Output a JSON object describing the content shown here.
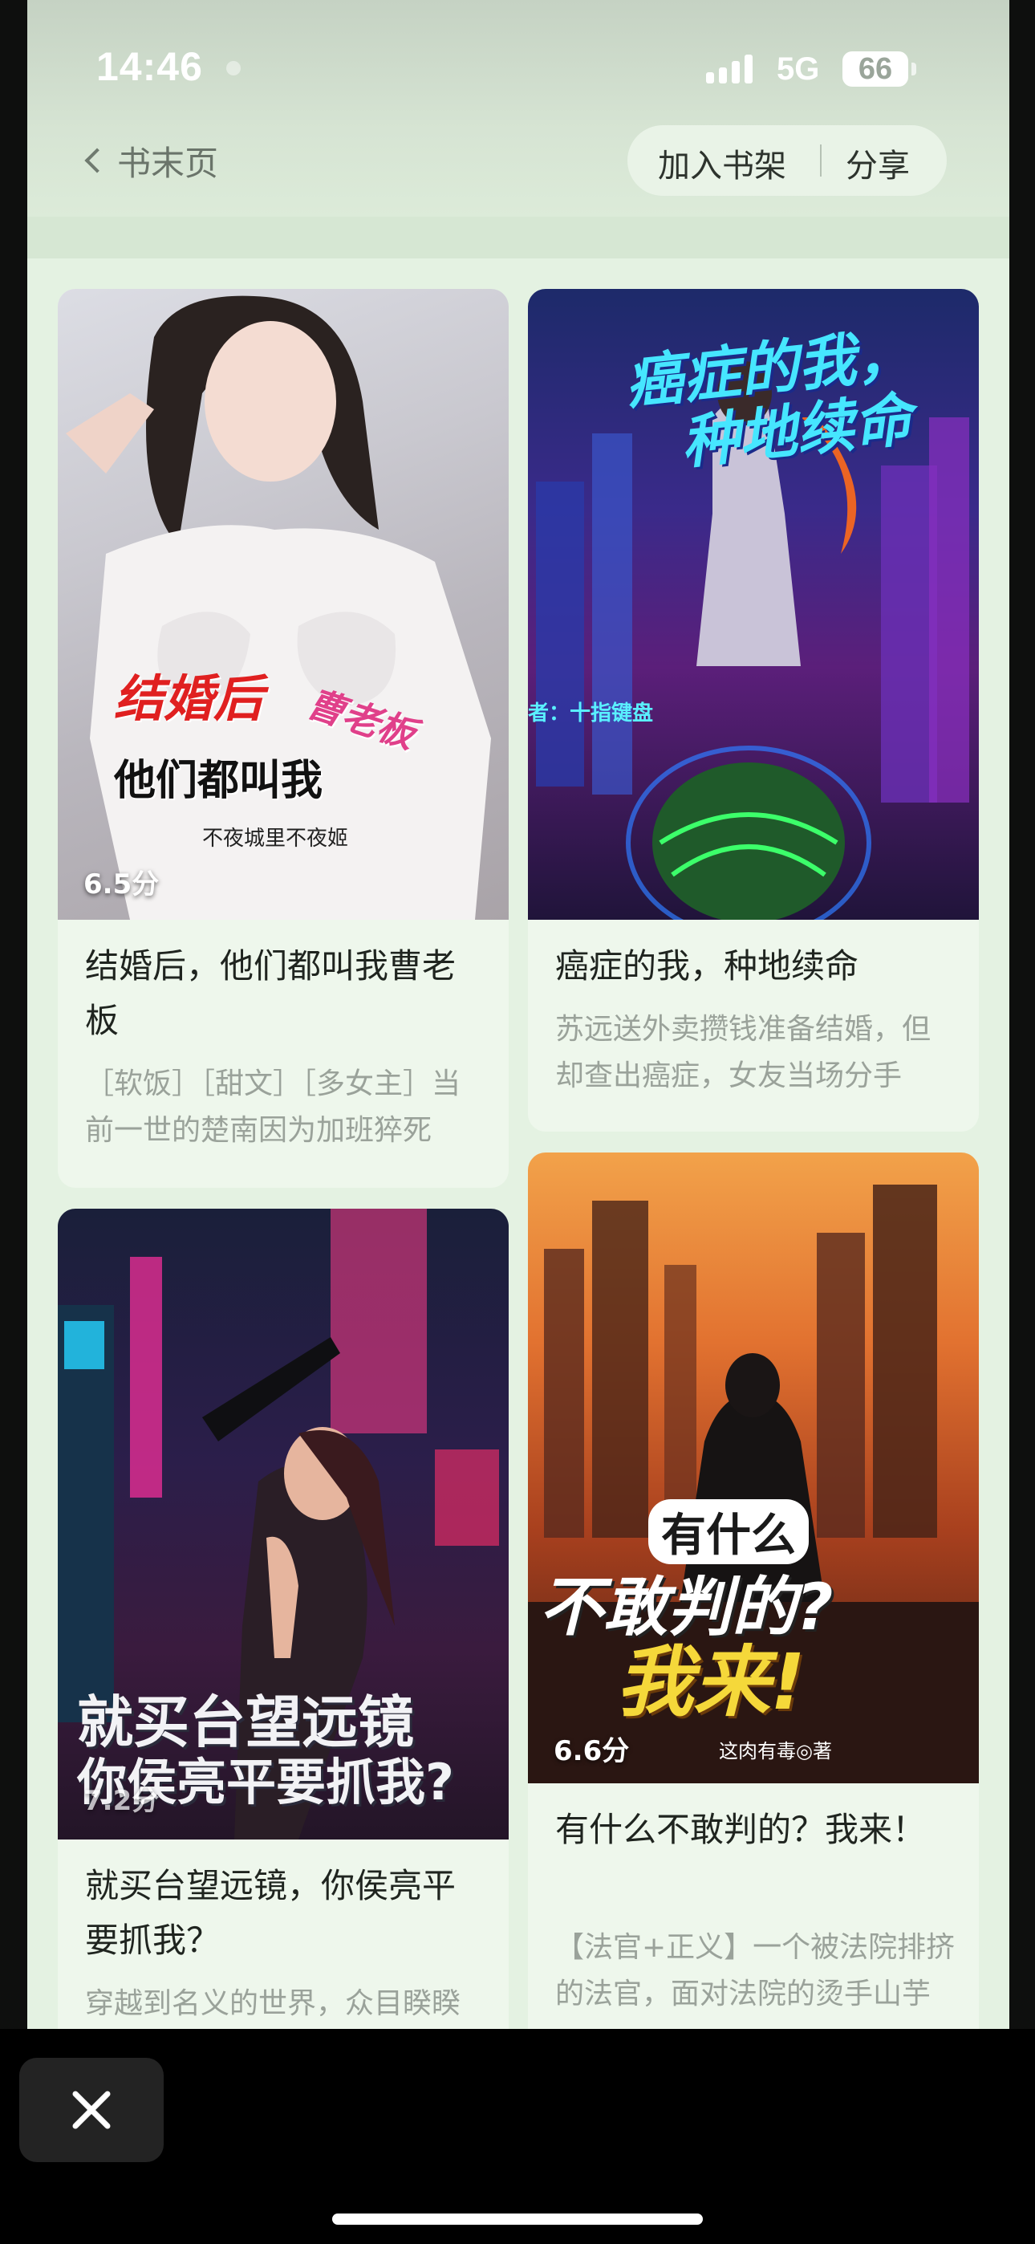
{
  "status_bar": {
    "time": "14:46",
    "network": "5G",
    "battery": "66"
  },
  "nav": {
    "back_label": "书末页",
    "add_to_shelf": "加入书架",
    "share": "分享"
  },
  "books": [
    {
      "title": "结婚后，他们都叫我曹老板",
      "desc": "［软饭］［甜文］［多女主］当前一世的楚南因为加班猝死",
      "score": "6.5分",
      "cover_title_1": "结婚后",
      "cover_title_2": "曹老板",
      "cover_title_3": "他们都叫我",
      "cover_author": "不夜城里不夜姬"
    },
    {
      "title": "癌症的我，种地续命",
      "desc": "苏远送外卖攒钱准备结婚，但却查出癌症，女友当场分手",
      "cover_title_1": "癌症的我，",
      "cover_title_2": "种地续命",
      "cover_author": "者：十指键盘"
    },
    {
      "title": "就买台望远镜，你侯亮平要抓我？",
      "desc": "穿越到名义的世界，众目睽睽",
      "score": "7.2分",
      "cover_title_1": "就买台望远镜",
      "cover_title_2": "你侯亮平要抓我?"
    },
    {
      "title": "有什么不敢判的？我来！",
      "desc": "【法官+正义】一个被法院排挤的法官，面对法院的烫手山芋",
      "score": "6.6分",
      "cover_title_1": "有什么",
      "cover_title_2": "不敢判的?",
      "cover_title_3": "我来!",
      "cover_author": "这肉有毒◎著"
    }
  ],
  "colors": {
    "page_bg": "#e4f2e2",
    "card_bg": "#eef7ec",
    "title_text": "#1f241f",
    "desc_text": "#9aa29a"
  }
}
